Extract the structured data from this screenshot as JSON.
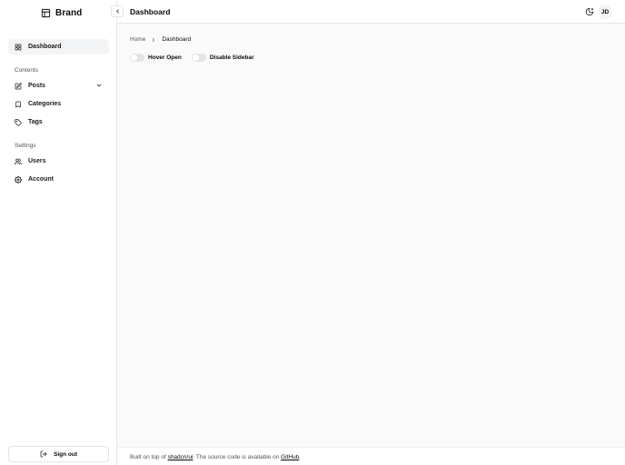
{
  "brand": {
    "label": "Brand",
    "icon": "panel-icon"
  },
  "sidebar": {
    "top_item": {
      "label": "Dashboard",
      "icon": "layout-grid-icon"
    },
    "groups": [
      {
        "label": "Contents",
        "items": [
          {
            "label": "Posts",
            "icon": "square-pen-icon"
          },
          {
            "label": "Categories",
            "icon": "bookmark-icon"
          },
          {
            "label": "Tags",
            "icon": "tag-icon"
          }
        ]
      },
      {
        "label": "Settings",
        "items": [
          {
            "label": "Users",
            "icon": "users-icon"
          },
          {
            "label": "Account",
            "icon": "settings-icon"
          }
        ]
      }
    ],
    "signout_label": "Sign out"
  },
  "header": {
    "title": "Dashboard",
    "avatar_initials": "JD"
  },
  "breadcrumb": {
    "home": "Home",
    "current": "Dashboard"
  },
  "toggles": [
    {
      "label": "Hover Open",
      "on": false
    },
    {
      "label": "Disable Sidebar",
      "on": false
    }
  ],
  "footer": {
    "prefix": "Built on top of ",
    "link1": "shadcn/ui",
    "middle": ". The source code is available on ",
    "link2": "GitHub",
    "suffix": "."
  }
}
